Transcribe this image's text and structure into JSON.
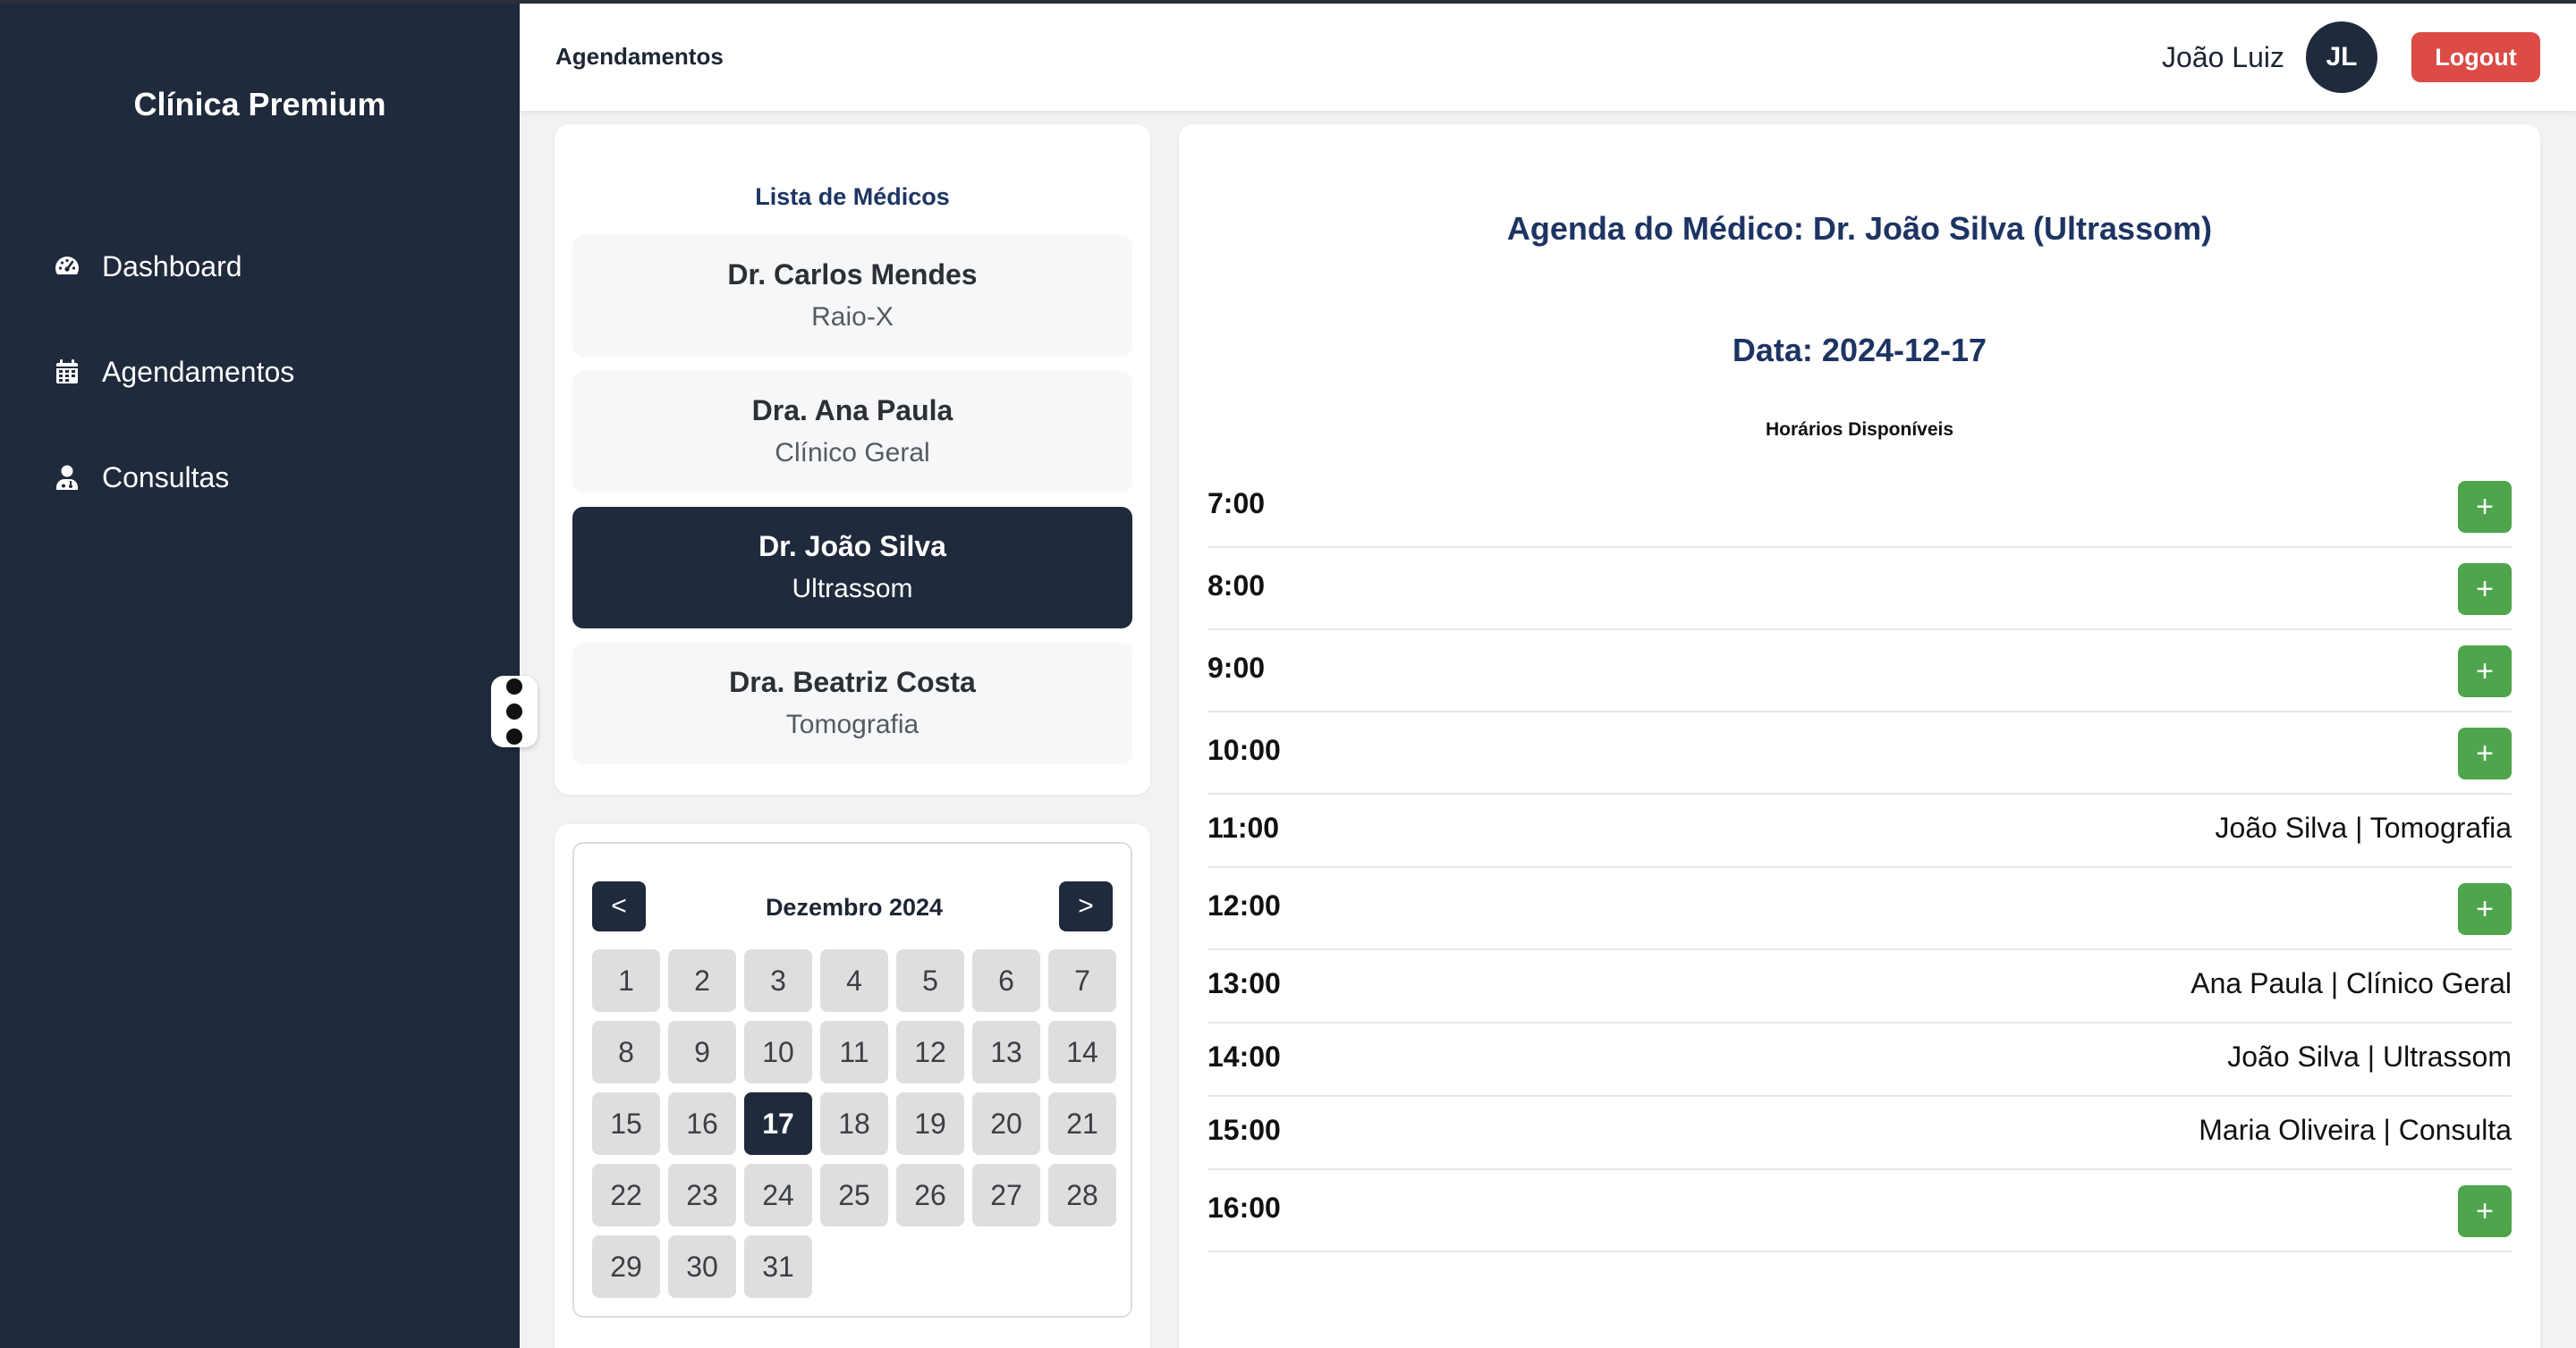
{
  "sidebar": {
    "brand": "Clínica Premium",
    "items": [
      {
        "label": "Dashboard",
        "icon": "gauge-icon"
      },
      {
        "label": "Agendamentos",
        "icon": "calendar-icon"
      },
      {
        "label": "Consultas",
        "icon": "doctor-icon"
      }
    ]
  },
  "header": {
    "title": "Agendamentos",
    "user_name": "João Luiz",
    "avatar_initials": "JL",
    "logout_label": "Logout"
  },
  "doctors": {
    "title": "Lista de Médicos",
    "items": [
      {
        "name": "Dr. Carlos Mendes",
        "specialty": "Raio-X",
        "selected": false
      },
      {
        "name": "Dra. Ana Paula",
        "specialty": "Clínico Geral",
        "selected": false
      },
      {
        "name": "Dr. João Silva",
        "specialty": "Ultrassom",
        "selected": true
      },
      {
        "name": "Dra. Beatriz Costa",
        "specialty": "Tomografia",
        "selected": false
      }
    ]
  },
  "calendar": {
    "month_label": "Dezembro 2024",
    "prev_label": "<",
    "next_label": ">",
    "days": [
      "1",
      "2",
      "3",
      "4",
      "5",
      "6",
      "7",
      "8",
      "9",
      "10",
      "11",
      "12",
      "13",
      "14",
      "15",
      "16",
      "17",
      "18",
      "19",
      "20",
      "21",
      "22",
      "23",
      "24",
      "25",
      "26",
      "27",
      "28",
      "29",
      "30",
      "31"
    ],
    "selected_day": "17"
  },
  "agenda": {
    "title": "Agenda do Médico: Dr. João Silva (Ultrassom)",
    "date_label": "Data: 2024-12-17",
    "subtitle": "Horários Disponíveis",
    "add_label": "+",
    "slots": [
      {
        "time": "7:00",
        "booking": ""
      },
      {
        "time": "8:00",
        "booking": ""
      },
      {
        "time": "9:00",
        "booking": ""
      },
      {
        "time": "10:00",
        "booking": ""
      },
      {
        "time": "11:00",
        "booking": "João Silva | Tomografia"
      },
      {
        "time": "12:00",
        "booking": ""
      },
      {
        "time": "13:00",
        "booking": "Ana Paula | Clínico Geral"
      },
      {
        "time": "14:00",
        "booking": "João Silva | Ultrassom"
      },
      {
        "time": "15:00",
        "booking": "Maria Oliveira | Consulta"
      },
      {
        "time": "16:00",
        "booking": ""
      }
    ]
  },
  "colors": {
    "sidebar_bg": "#1f2a3c",
    "logout": "#dc4b45",
    "add_button": "#4ea54b",
    "heading_blue": "#1d3463"
  }
}
